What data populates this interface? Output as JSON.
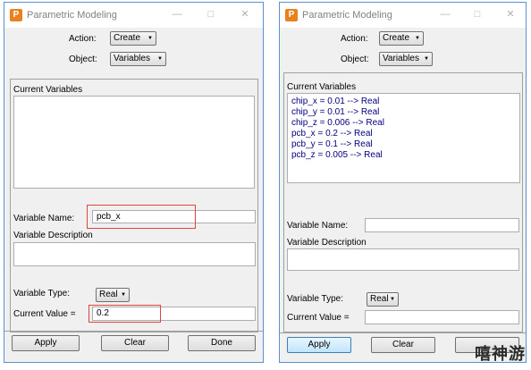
{
  "left_window": {
    "title": "Parametric Modeling",
    "app_icon_glyph": "P",
    "action_label": "Action:",
    "action_value": "Create",
    "object_label": "Object:",
    "object_value": "Variables",
    "current_variables_label": "Current Variables",
    "variables": [],
    "variable_name_label": "Variable Name:",
    "variable_name_value": "pcb_x",
    "variable_description_label": "Variable Description",
    "variable_type_label": "Variable Type:",
    "variable_type_value": "Real",
    "current_value_label": "Current Value =",
    "current_value_value": "0.2",
    "buttons": {
      "apply": "Apply",
      "clear": "Clear",
      "done": "Done"
    }
  },
  "right_window": {
    "title": "Parametric Modeling",
    "app_icon_glyph": "P",
    "action_label": "Action:",
    "action_value": "Create",
    "object_label": "Object:",
    "object_value": "Variables",
    "current_variables_label": "Current Variables",
    "variables": [
      "chip_x = 0.01 --> Real",
      "chip_y = 0.01 --> Real",
      "chip_z = 0.006 --> Real",
      "pcb_x = 0.2 --> Real",
      "pcb_y = 0.1 --> Real",
      "pcb_z = 0.005 --> Real"
    ],
    "variable_name_label": "Variable Name:",
    "variable_name_value": "",
    "variable_description_label": "Variable Description",
    "variable_type_label": "Variable Type:",
    "variable_type_value": "Real",
    "current_value_label": "Current Value =",
    "current_value_value": "",
    "buttons": {
      "apply": "Apply",
      "clear": "Clear"
    }
  },
  "icons": {
    "minimize": "minimize-icon",
    "maximize": "maximize-icon",
    "close": "close-icon",
    "dropdown": "chevron-down-icon"
  },
  "colors": {
    "window_border": "#5b8fd1",
    "app_icon": "#e9821e",
    "list_text": "#000080",
    "highlight": "#e0443a"
  },
  "watermark": "嘻神游"
}
